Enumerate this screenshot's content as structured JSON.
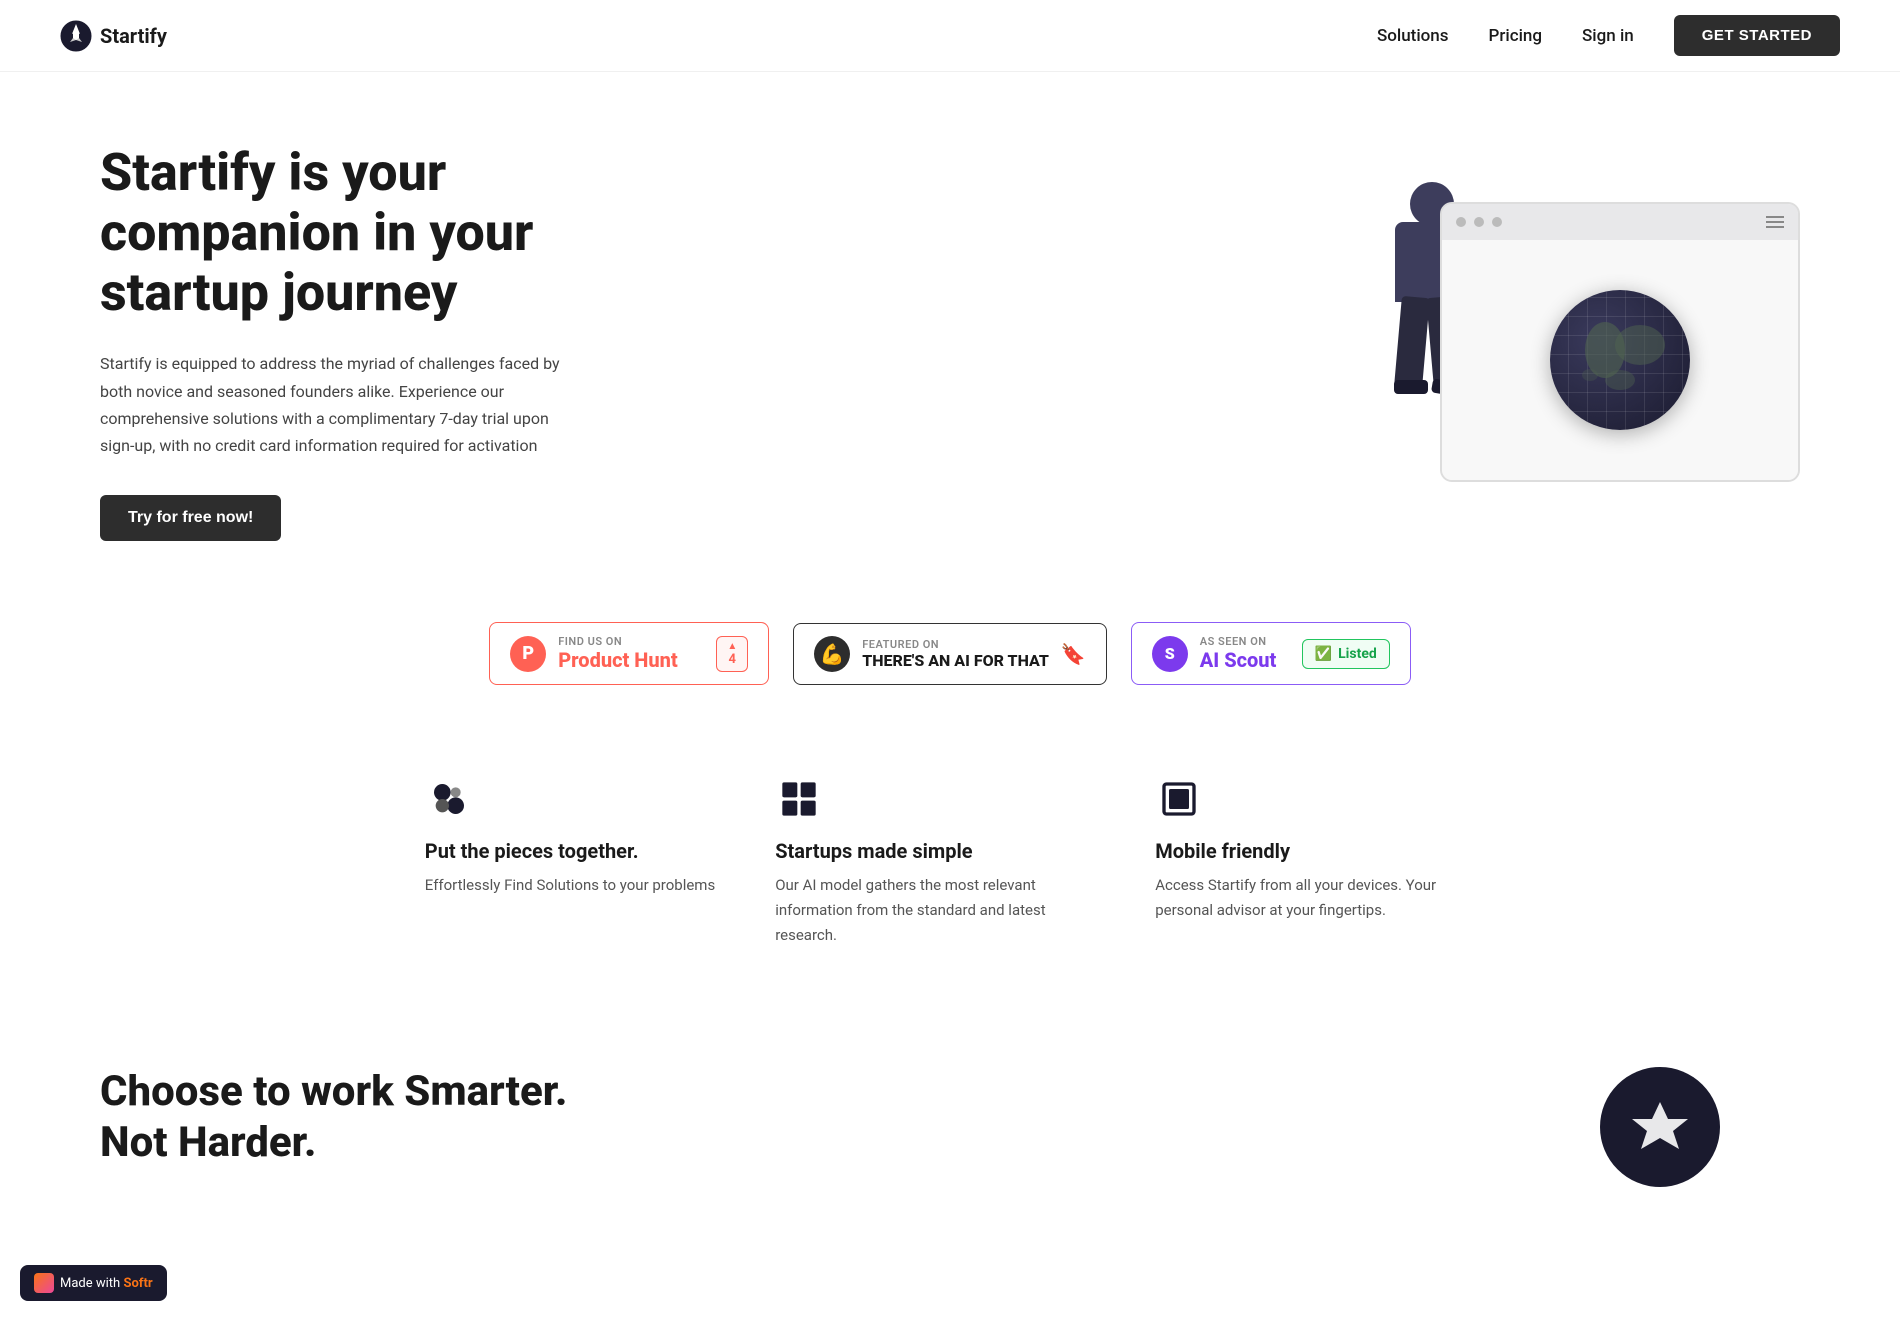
{
  "nav": {
    "logo_text": "Startify",
    "links": [
      {
        "label": "Solutions",
        "href": "#"
      },
      {
        "label": "Pricing",
        "href": "#"
      },
      {
        "label": "Sign in",
        "href": "#"
      }
    ],
    "cta_label": "GET STARTED"
  },
  "hero": {
    "title": "Startify is your companion in your startup journey",
    "description": "Startify is equipped to address the myriad of challenges faced by both novice and seasoned founders alike. Experience our comprehensive solutions with a complimentary 7-day trial upon sign-up, with no credit card information required for activation",
    "cta_label": "Try for free now!"
  },
  "badges": [
    {
      "id": "product-hunt",
      "label": "FIND US ON",
      "name": "Product Hunt",
      "type": "ph",
      "upvote": "4"
    },
    {
      "id": "theres-an-ai",
      "label": "FEATURED ON",
      "name": "THERE'S AN AI FOR THAT",
      "type": "ai"
    },
    {
      "id": "ai-scout",
      "label": "AS SEEN ON",
      "name": "AI Scout",
      "type": "scout",
      "listed_label": "Listed"
    }
  ],
  "features": [
    {
      "id": "pieces",
      "icon": "puzzle",
      "title": "Put the pieces together.",
      "description": "Effortlessly Find Solutions to your problems"
    },
    {
      "id": "simple",
      "icon": "grid",
      "title": "Startups made simple",
      "description": "Our AI model gathers the most relevant information from the standard and latest research."
    },
    {
      "id": "mobile",
      "icon": "crop",
      "title": "Mobile friendly",
      "description": "Access Startify from all your devices. Your personal advisor at your fingertips."
    }
  ],
  "bottom": {
    "title": "Choose to work Smarter. Not Harder."
  },
  "softr": {
    "prefix": "Made with ",
    "brand": "Softr"
  }
}
